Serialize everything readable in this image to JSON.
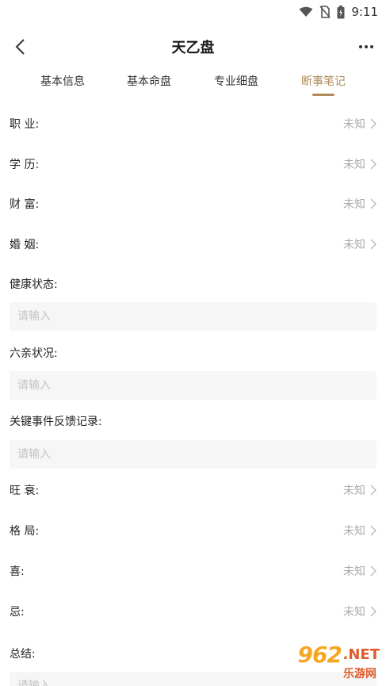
{
  "status_bar": {
    "time": "9:11"
  },
  "nav": {
    "title": "天乙盘"
  },
  "tabs": [
    {
      "label": "基本信息"
    },
    {
      "label": "基本命盘"
    },
    {
      "label": "专业细盘"
    },
    {
      "label": "断事笔记"
    }
  ],
  "form": {
    "select_rows": [
      {
        "label": "职  业:",
        "value": "未知"
      },
      {
        "label": "学  历:",
        "value": "未知"
      },
      {
        "label": "财  富:",
        "value": "未知"
      },
      {
        "label": "婚  姻:",
        "value": "未知"
      }
    ],
    "health": {
      "label": "健康状态:",
      "placeholder": "请输入"
    },
    "family": {
      "label": "六亲状况:",
      "placeholder": "请输入"
    },
    "events": {
      "label": "关键事件反馈记录:",
      "placeholder": "请输入"
    },
    "select_rows_2": [
      {
        "label": "旺  衰:",
        "value": "未知"
      },
      {
        "label": "格  局:",
        "value": "未知"
      },
      {
        "label": "喜:",
        "value": "未知"
      },
      {
        "label": "忌:",
        "value": "未知"
      }
    ],
    "summary": {
      "label": "总结:",
      "placeholder": "请输入"
    }
  },
  "watermark": {
    "number": "962",
    "suffix": ".NET",
    "subtitle": "乐游网"
  },
  "colors": {
    "accent": "#b08c5a",
    "muted": "#aaaaaa",
    "input_bg": "#f6f6f6"
  }
}
